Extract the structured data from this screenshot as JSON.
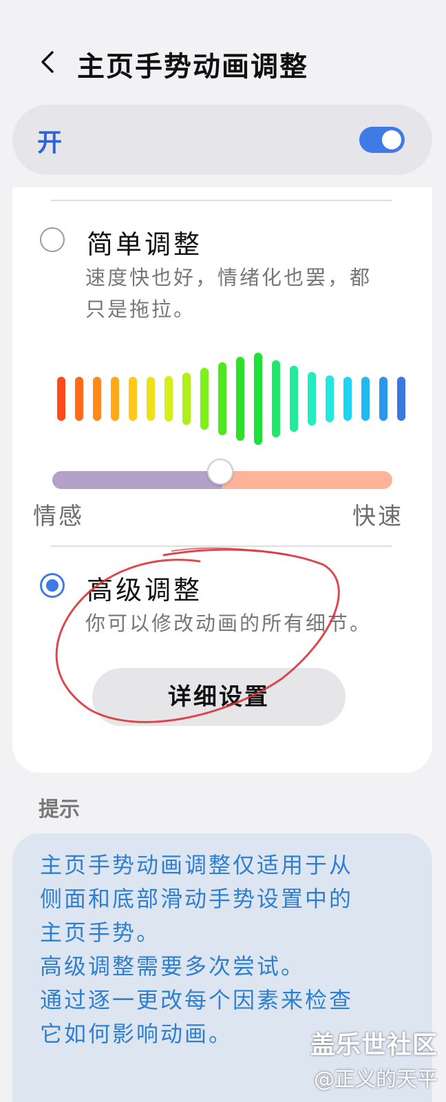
{
  "header": {
    "title": "主页手势动画调整"
  },
  "toggle": {
    "label": "开",
    "enabled": true,
    "accent_color": "#3f7ae6"
  },
  "options": {
    "simple": {
      "title": "简单调整",
      "description_lines": [
        "速度快也好，情绪化也罢，都",
        "只是拖拉。"
      ],
      "selected": false
    },
    "slider": {
      "left_label": "情感",
      "right_label": "快速",
      "value_fraction": 0.5
    },
    "advanced": {
      "title": "高级调整",
      "description": "你可以修改动画的所有细节。",
      "selected": true
    },
    "detail_button": {
      "label": "详细设置"
    }
  },
  "hint": {
    "label": "提示",
    "lines": [
      "主页手势动画调整仅适用于从",
      "侧面和底部滑动手势设置中的",
      "主页手势。",
      "高级调整需要多次尝试。",
      "通过逐一更改每个因素来检查",
      "它如何影响动画。"
    ]
  },
  "watermark": {
    "line1": "盖乐世社区",
    "line2": "@正义的天平"
  },
  "colors": {
    "accent": "#3f7ae6",
    "hint_text": "#2e7fd0",
    "annotation_circle": "#d9343a"
  },
  "icons": {
    "back": "chevron-left-icon"
  }
}
